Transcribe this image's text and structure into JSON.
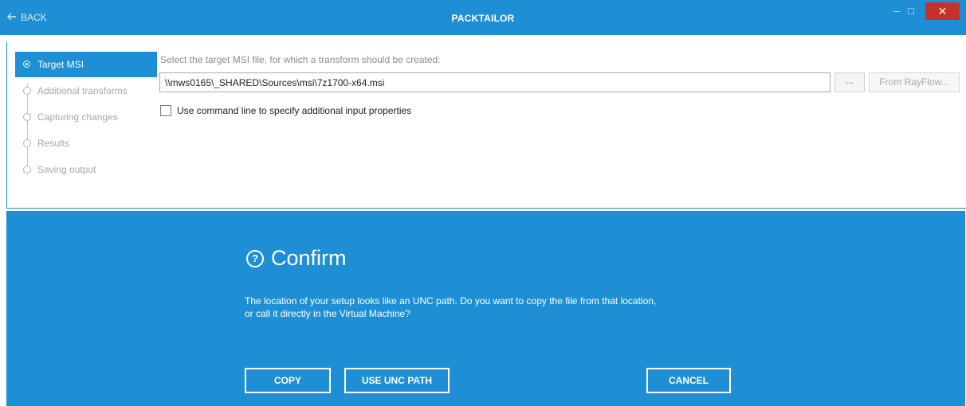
{
  "titlebar": {
    "back_icon": "arrow-left-icon",
    "back_label": "BACK",
    "title": "PACKTAILOR",
    "minimize_glyph": "–",
    "maximize_glyph": "□",
    "close_glyph": "✕"
  },
  "steps": [
    {
      "label": "Target MSI",
      "active": true
    },
    {
      "label": "Additional transforms",
      "active": false
    },
    {
      "label": "Capturing changes",
      "active": false
    },
    {
      "label": "Results",
      "active": false
    },
    {
      "label": "Saving output",
      "active": false
    }
  ],
  "target": {
    "hint": "Select the target MSI file, for which a transform should be created:",
    "path_value": "\\\\mws0165\\_SHARED\\Sources\\msi\\7z1700-x64.msi",
    "browse_label": "...",
    "rayflow_label": "From RayFlow...",
    "cmdline_checked": false,
    "cmdline_label": "Use command line to specify additional input properties"
  },
  "confirm": {
    "icon": "question-circle-icon",
    "icon_glyph": "?",
    "title": "Confirm",
    "message_line1": "The location of your setup looks like an UNC path. Do you want to copy the file from that location,",
    "message_line2": "or call it directly in the Virtual Machine?",
    "copy_label": "COPY",
    "unc_label": "USE UNC PATH",
    "cancel_label": "CANCEL"
  },
  "colors": {
    "accent": "#1e8fd5",
    "close": "#c7312c"
  }
}
